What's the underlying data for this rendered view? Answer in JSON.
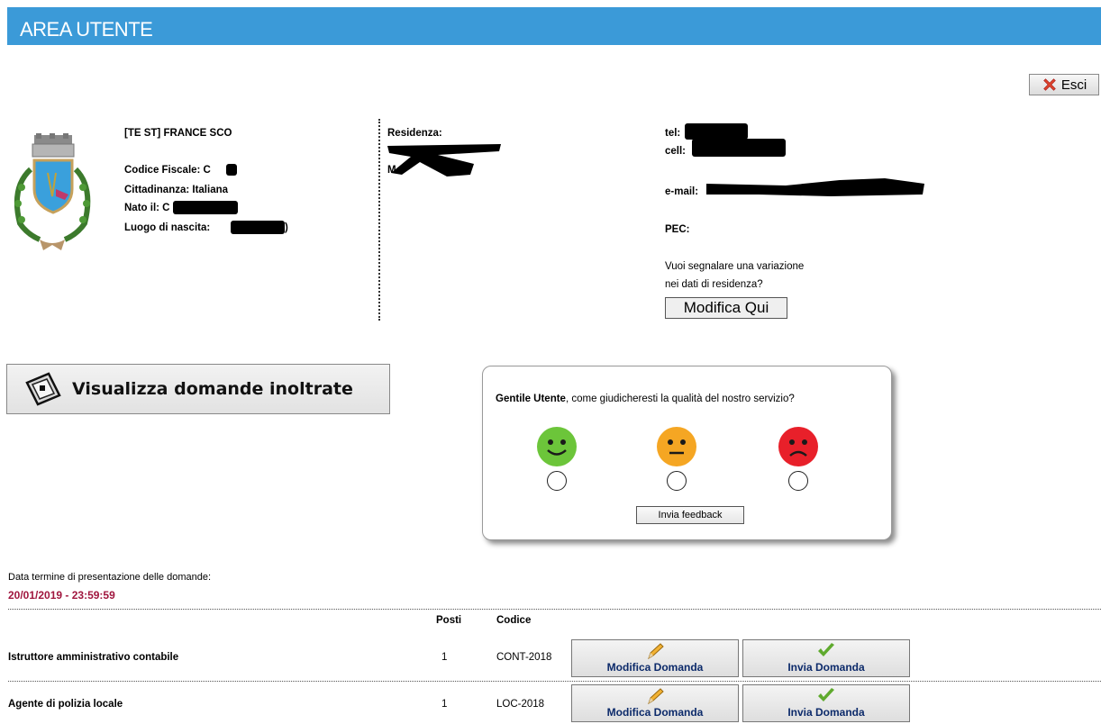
{
  "header": {
    "title": "AREA UTENTE"
  },
  "logout": {
    "label": "Esci",
    "icon": "close-x-icon"
  },
  "user": {
    "name": "[TE ST] FRANCE SCO",
    "codice_fiscale_label": "Codice Fiscale: C",
    "cittadinanza": "Cittadinanza: Italiana",
    "nato_il_label": "Nato il: C",
    "luogo_label": "Luogo di nascita:",
    "luogo_suffix": ")",
    "residenza_label": "Residenza:",
    "residenza_line2_prefix": "M",
    "tel_label": "tel:",
    "cell_label": "cell:",
    "email_label": "e-mail:",
    "pec_label": "PEC:"
  },
  "residence_change": {
    "question_line1": "Vuoi segnalare una variazione",
    "question_line2": "nei dati di residenza?",
    "button_label": "Modifica Qui"
  },
  "view_applications": {
    "label": "Visualizza domande inoltrate"
  },
  "feedback": {
    "question_bold": "Gentile Utente",
    "question_rest": ", come giudicheresti la qualità del nostro servizio?",
    "options": [
      "happy",
      "neutral",
      "sad"
    ],
    "colors": {
      "happy": "#6cc53a",
      "neutral": "#f5a623",
      "sad": "#e8202a"
    },
    "send_label": "Invia feedback"
  },
  "deadline": {
    "label": "Data termine di presentazione delle domande:",
    "value": "20/01/2019 - 23:59:59"
  },
  "table": {
    "headers": {
      "posti": "Posti",
      "codice": "Codice"
    },
    "rows": [
      {
        "title": "Istruttore amministrativo contabile",
        "posti": "1",
        "codice": "CONT-2018",
        "edit_label": "Modifica Domanda",
        "send_label": "Invia Domanda"
      },
      {
        "title": "Agente di polizia locale",
        "posti": "1",
        "codice": "LOC-2018",
        "edit_label": "Modifica Domanda",
        "send_label": "Invia Domanda"
      }
    ]
  }
}
